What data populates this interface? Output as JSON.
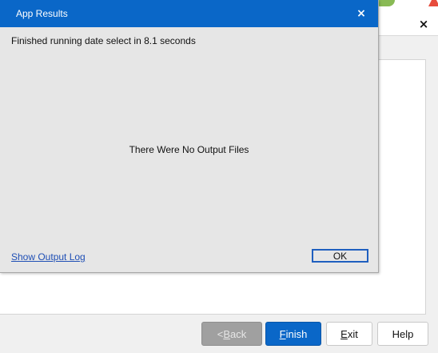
{
  "dialog": {
    "title": "App Results",
    "close_glyph": "×",
    "status_text": "Finished running date select in 8.1 seconds",
    "no_output_text": "There Were No Output Files",
    "output_log_link": "Show Output Log",
    "ok_label": "OK",
    "title_bar_color": "#0a67c8"
  },
  "parent_window": {
    "close_glyph": "×",
    "buttons": {
      "back_prefix": "< ",
      "back_accel": "B",
      "back_rest": "ack",
      "finish_accel": "F",
      "finish_rest": "inish",
      "exit_accel": "E",
      "exit_rest": "xit",
      "help_label": "Help"
    },
    "accent_color": "#0a67c8",
    "disabled_color": "#a0a0a0"
  }
}
